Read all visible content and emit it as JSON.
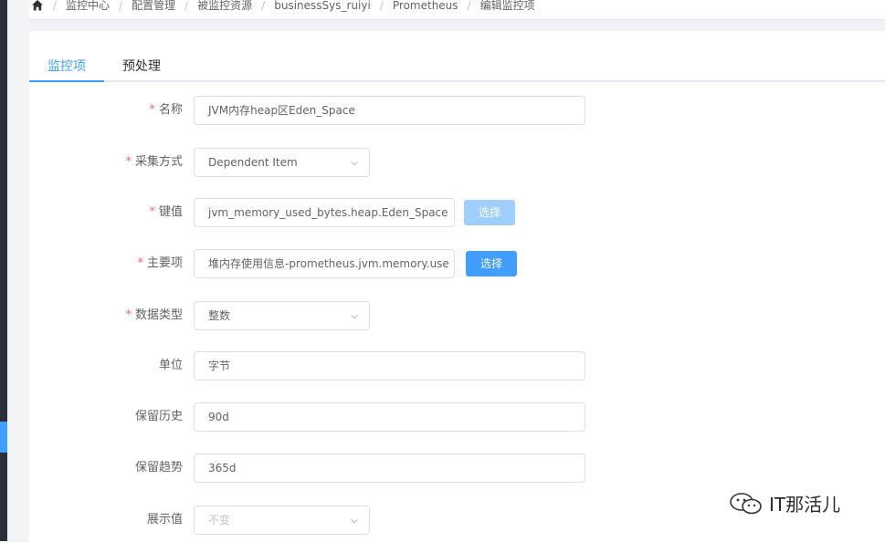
{
  "breadcrumb": [
    "监控中心",
    "配置管理",
    "被监控资源",
    "businessSys_ruiyi",
    "Prometheus",
    "编辑监控项"
  ],
  "tabs": [
    {
      "label": "监控项",
      "active": true
    },
    {
      "label": "预处理",
      "active": false
    }
  ],
  "form": {
    "required_mark": "*",
    "name": {
      "label": "名称",
      "value": "JVM内存heap区Eden_Space"
    },
    "collect_method": {
      "label": "采集方式",
      "value": "Dependent Item"
    },
    "key": {
      "label": "键值",
      "value": "jvm_memory_used_bytes.heap.Eden_Space",
      "button": "选择"
    },
    "master_item": {
      "label": "主要项",
      "value": "堆内存使用信息-prometheus.jvm.memory.use",
      "button": "选择"
    },
    "data_type": {
      "label": "数据类型",
      "value": "整数"
    },
    "unit": {
      "label": "单位",
      "value": "字节"
    },
    "history": {
      "label": "保留历史",
      "value": "90d"
    },
    "trends": {
      "label": "保留趋势",
      "value": "365d"
    },
    "display_value": {
      "label": "展示值",
      "value": "不变"
    }
  },
  "watermark": {
    "text": "IT那活儿"
  },
  "colors": {
    "accent": "#409eff",
    "required": "#f56c6c",
    "disabled_button": "#a0cfff"
  },
  "icons": [
    "home-icon",
    "chevron-down-icon",
    "wechat-icon"
  ]
}
